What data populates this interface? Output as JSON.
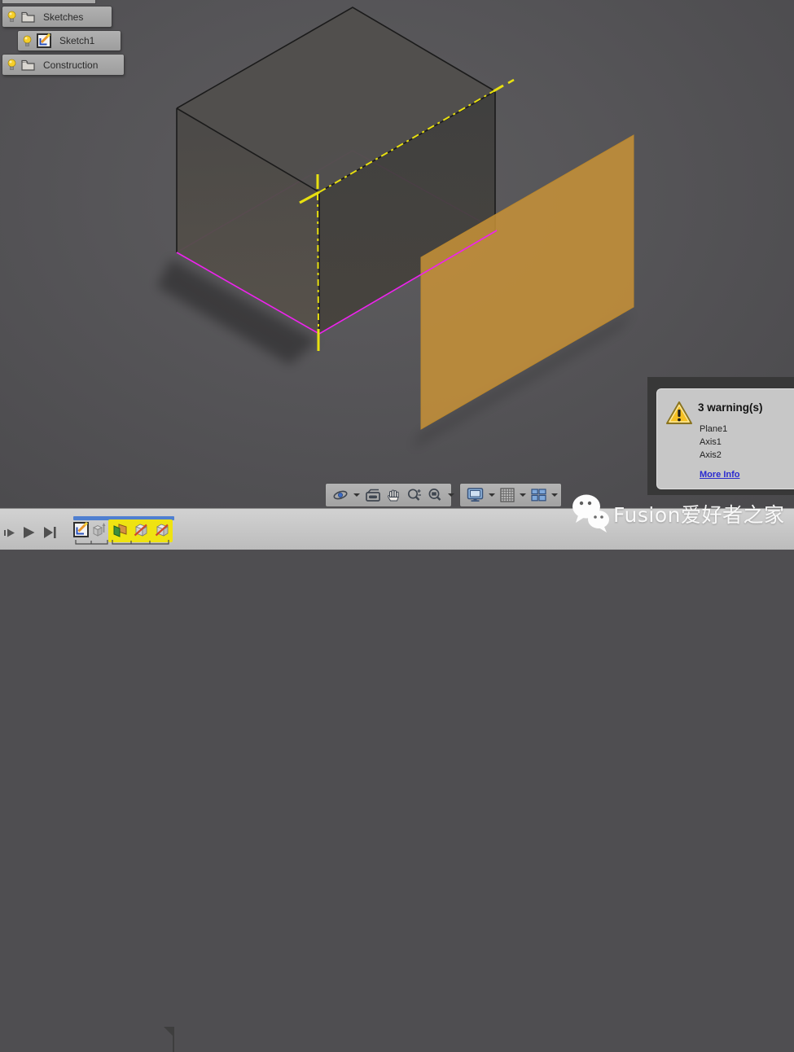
{
  "browser": {
    "items": [
      {
        "label": "Sketches"
      },
      {
        "label": "Sketch1"
      },
      {
        "label": "Construction"
      }
    ]
  },
  "warning": {
    "title": "3 warning(s)",
    "items": [
      "Plane1",
      "Axis1",
      "Axis2"
    ],
    "link": "More Info"
  },
  "nav": {
    "group1": [
      "orbit",
      "look-at",
      "pan",
      "zoom",
      "fit"
    ],
    "group2": [
      "display-settings",
      "grid",
      "viewports"
    ]
  },
  "timeline": {
    "playback": [
      "step-forward",
      "play",
      "go-to-end"
    ],
    "features": [
      "sketch1",
      "extrude1",
      "plane1",
      "axis1",
      "axis2"
    ]
  },
  "watermark": {
    "text": "Fusion爱好者之家"
  },
  "colors": {
    "construction_plane": "#c79238",
    "sketch_outline": "#e01fe0",
    "axis_yellow": "#e8e010",
    "timeline_highlight": "#efe312",
    "warning_yellow": "#f5b91e",
    "link_blue": "#2a2ad0"
  }
}
